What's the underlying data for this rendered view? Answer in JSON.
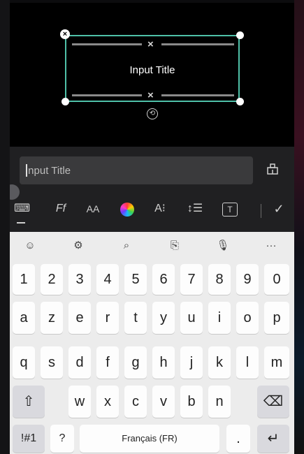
{
  "canvas": {
    "title_text": "Input Title",
    "close_glyph": "×",
    "delete_glyph": "×",
    "rotate_glyph": "⟲"
  },
  "editor": {
    "input_value": "Input Title",
    "eraser_icon": "eraser-icon",
    "tools": [
      {
        "id": "keyboard",
        "label": "⌨"
      },
      {
        "id": "font",
        "label": "Ff"
      },
      {
        "id": "size",
        "label": "AA"
      },
      {
        "id": "color",
        "label": ""
      },
      {
        "id": "style",
        "label": "A⁝"
      },
      {
        "id": "spacing",
        "label": "↕☰"
      },
      {
        "id": "textbox",
        "label": "T"
      },
      {
        "id": "confirm",
        "label": "✓"
      }
    ]
  },
  "keyboard": {
    "suggestions": [
      {
        "name": "emoji-icon",
        "glyph": "☺"
      },
      {
        "name": "settings-icon",
        "glyph": "⚙"
      },
      {
        "name": "search-icon",
        "glyph": "⌕"
      },
      {
        "name": "clipboard-icon",
        "glyph": "⎘"
      },
      {
        "name": "microphone-icon",
        "glyph": "🎙"
      },
      {
        "name": "more-icon",
        "glyph": "···"
      }
    ],
    "row1": [
      "1",
      "2",
      "3",
      "4",
      "5",
      "6",
      "7",
      "8",
      "9",
      "0"
    ],
    "row2": [
      "a",
      "z",
      "e",
      "r",
      "t",
      "y",
      "u",
      "i",
      "o",
      "p"
    ],
    "row3": [
      "q",
      "s",
      "d",
      "f",
      "g",
      "h",
      "j",
      "k",
      "l",
      "m"
    ],
    "row4": [
      "w",
      "x",
      "c",
      "v",
      "b",
      "n"
    ],
    "shift": "⇧",
    "backspace": "⌫",
    "symbols": "!#1",
    "question": "?",
    "space": "Français (FR)",
    "period": ".",
    "enter": "↵"
  }
}
